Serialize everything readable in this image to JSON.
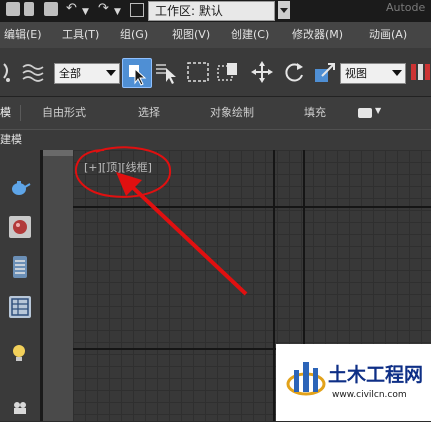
{
  "titlebar": {
    "workspace_label": "工作区: 默认",
    "brand": "Autode"
  },
  "menu": {
    "items": [
      "编辑(E)",
      "工具(T)",
      "组(G)",
      "视图(V)",
      "创建(C)",
      "修改器(M)",
      "动画(A)"
    ]
  },
  "toolbar": {
    "selection_filter": "全部",
    "reference_coord": "视图"
  },
  "ribbon": {
    "tabs": [
      "模",
      "自由形式",
      "选择",
      "对象绘制",
      "填充"
    ]
  },
  "subtab": {
    "label": "建模"
  },
  "viewport": {
    "label": "[+][顶][线框]"
  },
  "watermark": {
    "title": "土木工程网",
    "url": "www.civilcn.com"
  },
  "colors": {
    "annotation": "#e01010",
    "accent": "#3d8ed8",
    "watermark_blue": "#0e2f86"
  }
}
